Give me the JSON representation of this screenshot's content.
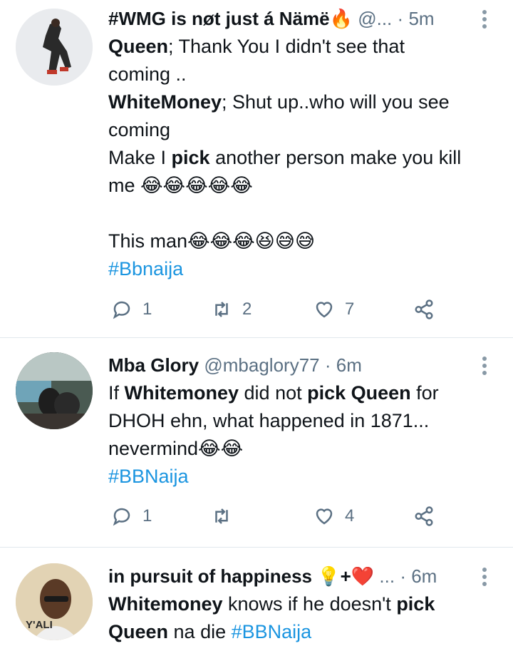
{
  "tweets": [
    {
      "name": "#WMG is nøt just á Nämë🔥",
      "handle": "@...",
      "dot": "·",
      "time": "5m",
      "lines": [
        {
          "b": "Queen",
          "t": "; Thank You I didn't see that"
        },
        {
          "t": "coming .."
        },
        {
          "b": "WhiteMoney",
          "t": "; Shut up..who will you see"
        },
        {
          "t": "coming"
        },
        {
          "t": "Make I ",
          "b2": "pick",
          "t2": " another person make you kill"
        },
        {
          "t": "me 😂😂😂😂😂"
        },
        {
          "t": ""
        },
        {
          "t": "This man😂😂😂😆😅😅"
        }
      ],
      "hashtag": "#Bbnaija",
      "replies": "1",
      "retweets": "2",
      "likes": "7"
    },
    {
      "name": "Mba Glory",
      "handle": "@mbaglory77",
      "dot": "·",
      "time": "6m",
      "lines": [
        {
          "t": "If ",
          "b": "Whitemoney",
          "t2": " did not ",
          "b2": "pick Queen",
          "t3": " for"
        },
        {
          "t": "DHOH ehn, what happened in 1871..."
        },
        {
          "t": "nevermind😂😂"
        }
      ],
      "hashtag": "#BBNaija",
      "replies": "1",
      "retweets": "",
      "likes": "4"
    },
    {
      "name": "in pursuit of happiness 💡+❤️",
      "handle": "...",
      "dot": "·",
      "time": "6m",
      "line1_b": "Whitemoney",
      "line1_t": " knows if he doesn't ",
      "line1_b2": "pick",
      "line2_b": "Queen",
      "line2_t": " na die ",
      "hashtag": "#BBNaija"
    }
  ],
  "avatar3_text": "Y'ALI",
  "colors": {
    "link": "#1b95e0",
    "muted": "#5b7083",
    "divider": "#e1e8ed"
  }
}
